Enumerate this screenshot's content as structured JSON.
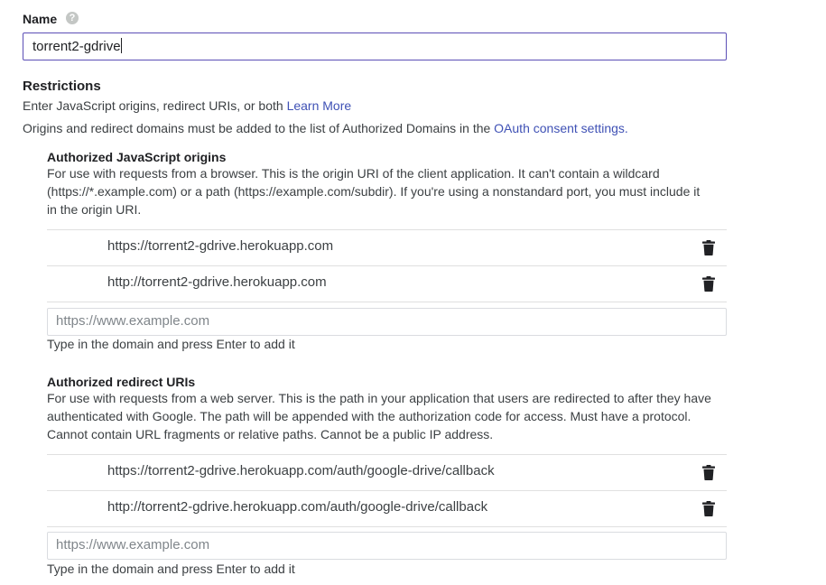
{
  "name_field": {
    "label": "Name",
    "value": "torrent2-gdrive"
  },
  "restrictions": {
    "heading": "Restrictions",
    "intro": "Enter JavaScript origins, redirect URIs, or both",
    "learn_more": "Learn More",
    "origins_note_prefix": "Origins and redirect domains must be added to the list of Authorized Domains in the",
    "oauth_link": "OAuth consent settings.",
    "js_origins": {
      "title": "Authorized JavaScript origins",
      "description_line1": "For use with requests from a browser. This is the origin URI of the client application. It can't contain a wildcard",
      "description_line2": "(https://*.example.com) or a path (https://example.com/subdir). If you're using a nonstandard port, you must include it",
      "description_line3": "in the origin URI.",
      "items": [
        "https://torrent2-gdrive.herokuapp.com",
        "http://torrent2-gdrive.herokuapp.com"
      ],
      "placeholder": "https://www.example.com",
      "hint": "Type in the domain and press Enter to add it"
    },
    "redirect_uris": {
      "title": "Authorized redirect URIs",
      "description_line1": "For use with requests from a web server. This is the path in your application that users are redirected to after they have",
      "description_line2": "authenticated with Google. The path will be appended with the authorization code for access. Must have a protocol.",
      "description_line3": "Cannot contain URL fragments or relative paths. Cannot be a public IP address.",
      "items": [
        "https://torrent2-gdrive.herokuapp.com/auth/google-drive/callback",
        "http://torrent2-gdrive.herokuapp.com/auth/google-drive/callback"
      ],
      "placeholder": "https://www.example.com",
      "hint": "Type in the domain and press Enter to add it"
    }
  },
  "icons": {
    "help": "help-circle-icon",
    "delete": "trash-icon"
  },
  "colors": {
    "link": "#3f51b5",
    "focus_border": "#5c4fb6"
  }
}
